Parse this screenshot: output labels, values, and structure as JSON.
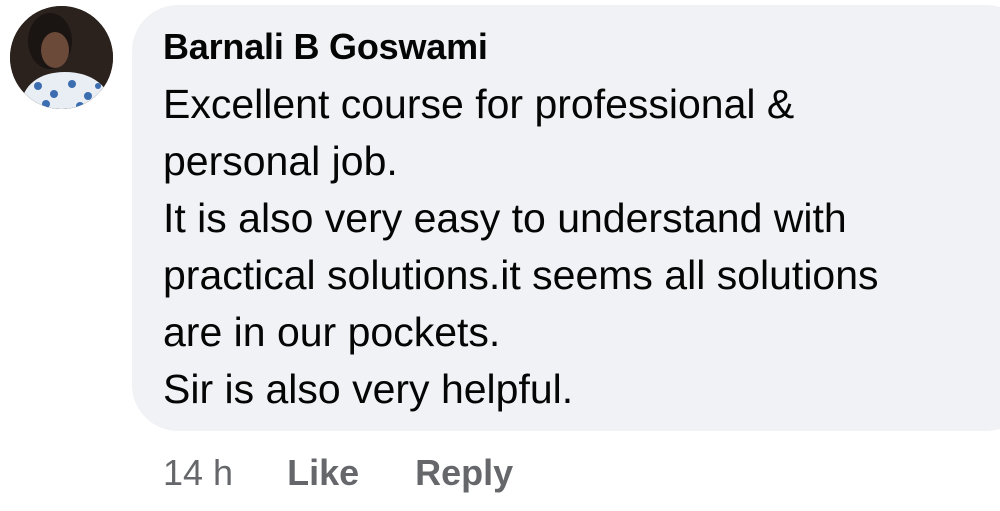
{
  "comment": {
    "author": "Barnali B Goswami",
    "lines": [
      "Excellent course for professional &",
      "personal job.",
      "It is also very easy to understand with",
      "practical solutions.it seems all solutions",
      "are in our pockets.",
      "Sir is also very helpful."
    ],
    "timestamp": "14 h",
    "like_label": "Like",
    "reply_label": "Reply"
  },
  "colors": {
    "bubble_bg": "#f0f2f5",
    "text": "#050505",
    "meta_text": "#65676b"
  }
}
